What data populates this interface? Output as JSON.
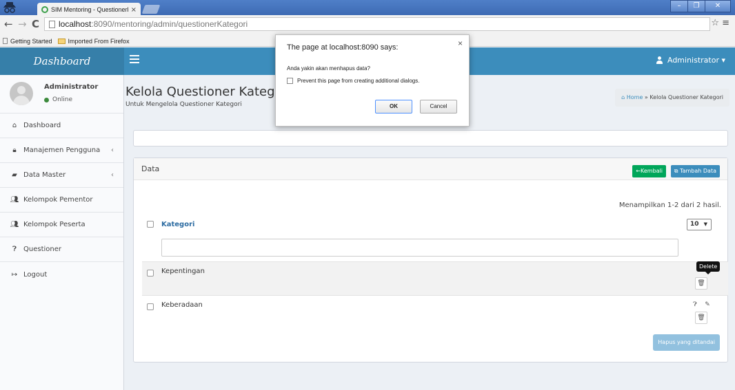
{
  "browser": {
    "tab_title": "SIM Mentoring - Questionerk",
    "tab_close": "×",
    "url_host": "localhost",
    "url_path": ":8090/mentoring/admin/questionerKategori",
    "bookmarks": [
      "Getting Started",
      "Imported From Firefox"
    ],
    "window_controls": [
      "–",
      "❐",
      "✕"
    ]
  },
  "header": {
    "logo": "Dashboard",
    "user_menu": "Administrator ▾"
  },
  "sidebar": {
    "user_name": "Administrator",
    "user_status": "Online",
    "items": [
      {
        "label": "Dashboard",
        "icon": "home-icon",
        "glyph": "⌂"
      },
      {
        "label": "Manajemen Pengguna",
        "icon": "lock-icon",
        "glyph": "🔒︎",
        "caret": "‹"
      },
      {
        "label": "Data Master",
        "icon": "book-icon",
        "glyph": "▰",
        "caret": "‹"
      },
      {
        "label": "Kelompok Pementor",
        "icon": "users-icon",
        "glyph": "👥︎"
      },
      {
        "label": "Kelompok Peserta",
        "icon": "users-icon",
        "glyph": "👥︎"
      },
      {
        "label": "Questioner",
        "icon": "question-circle-icon",
        "glyph": "❓︎"
      },
      {
        "label": "Logout",
        "icon": "sign-out-icon",
        "glyph": "↦"
      }
    ]
  },
  "content": {
    "title": "Kelola Questioner Kategori",
    "subtitle": "Untuk Mengelola Questioner Kategori",
    "breadcrumb_home": "Home",
    "breadcrumb_sep": "»",
    "breadcrumb_current": "Kelola Questioner Kategori"
  },
  "data_box": {
    "title": "Data",
    "back_label": "←Kembali",
    "add_label": "Tambah Data",
    "summary": "Menampilkan 1-2 dari 2 hasil.",
    "column": "Kategori",
    "page_size": "10",
    "rows": [
      {
        "label": "Kepentingan"
      },
      {
        "label": "Keberadaan"
      }
    ],
    "tooltip": "Delete",
    "bulk_delete_label": "Hapus yang ditandai"
  },
  "dialog": {
    "title": "The page at localhost:8090 says:",
    "message": "Anda yakin akan menhapus data?",
    "checkbox_label": "Prevent this page from creating additional dialogs.",
    "ok_label": "OK",
    "cancel_label": "Cancel"
  }
}
